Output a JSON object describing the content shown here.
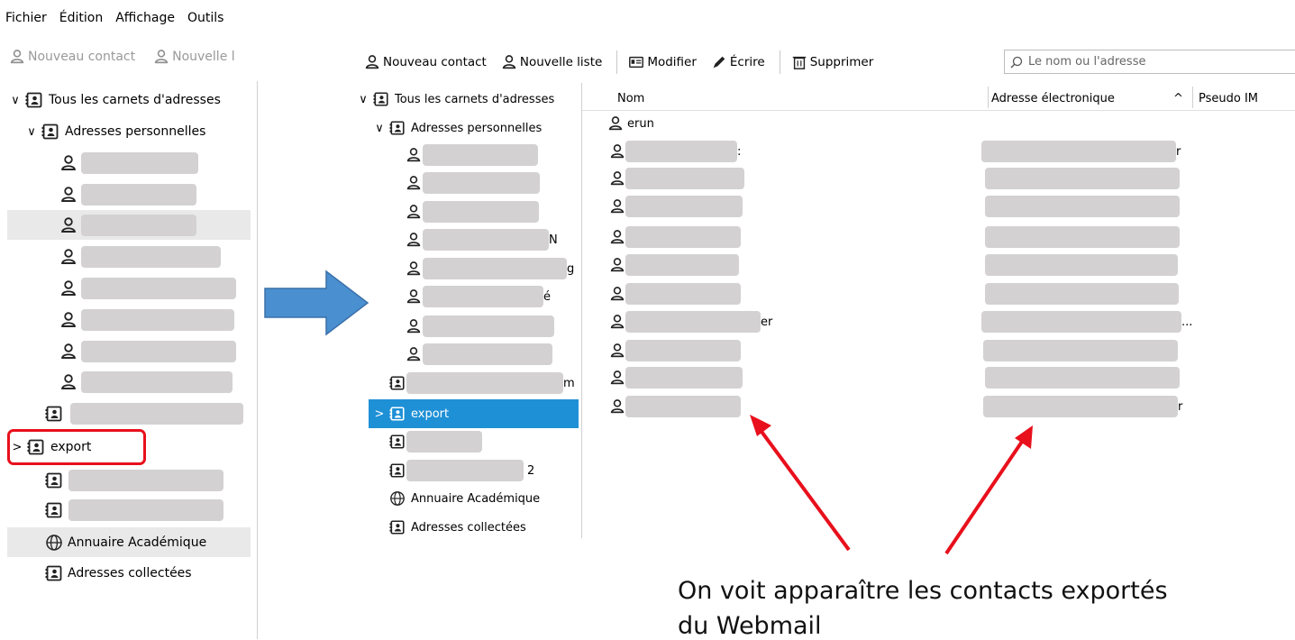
{
  "left_window": {
    "menu": {
      "file": "Fichier",
      "edit": "Édition",
      "view": "Affichage",
      "tools": "Outils"
    },
    "toolbar": {
      "new_contact": "Nouveau contact",
      "new_list": "Nouvelle l"
    },
    "tree": {
      "all_books": "Tous les carnets d'adresses",
      "personal": "Adresses personnelles",
      "export": "export",
      "academic": "Annuaire Académique",
      "collected": "Adresses collectées"
    }
  },
  "right_window": {
    "toolbar": {
      "new_contact": "Nouveau contact",
      "new_list": "Nouvelle liste",
      "edit": "Modifier",
      "write": "Écrire",
      "delete": "Supprimer"
    },
    "search": {
      "placeholder": "Le nom ou l'adresse"
    },
    "tree": {
      "all_books": "Tous les carnets d'adresses",
      "personal": "Adresses personnelles",
      "book1_suffix": "m",
      "export": "export",
      "book3_suffix": "2",
      "academic": "Annuaire Académique",
      "collected": "Adresses collectées"
    },
    "columns": {
      "name": "Nom",
      "email": "Adresse électronique",
      "sort_indicator": "^",
      "pseudo": "Pseudo IM"
    },
    "contacts": {
      "first_name": "erun"
    },
    "row_suffixes": {
      "tree_n": "N",
      "tree_g": "g",
      "tree_e": "é",
      "name_colon": ":",
      "name_er": "er",
      "email_r1": "r",
      "email_ellipsis": "...",
      "email_r2": "r"
    }
  },
  "annotation": {
    "caption_line1": "On voit apparaître les contacts exportés",
    "caption_line2": "du Webmail",
    "arrow_color": "#e8101c",
    "big_arrow_color": "#4a8fd0"
  },
  "colors": {
    "selection": "#1e90d6",
    "highlight_row": "#e9e9e9",
    "redacted": "#d4d1d3"
  }
}
